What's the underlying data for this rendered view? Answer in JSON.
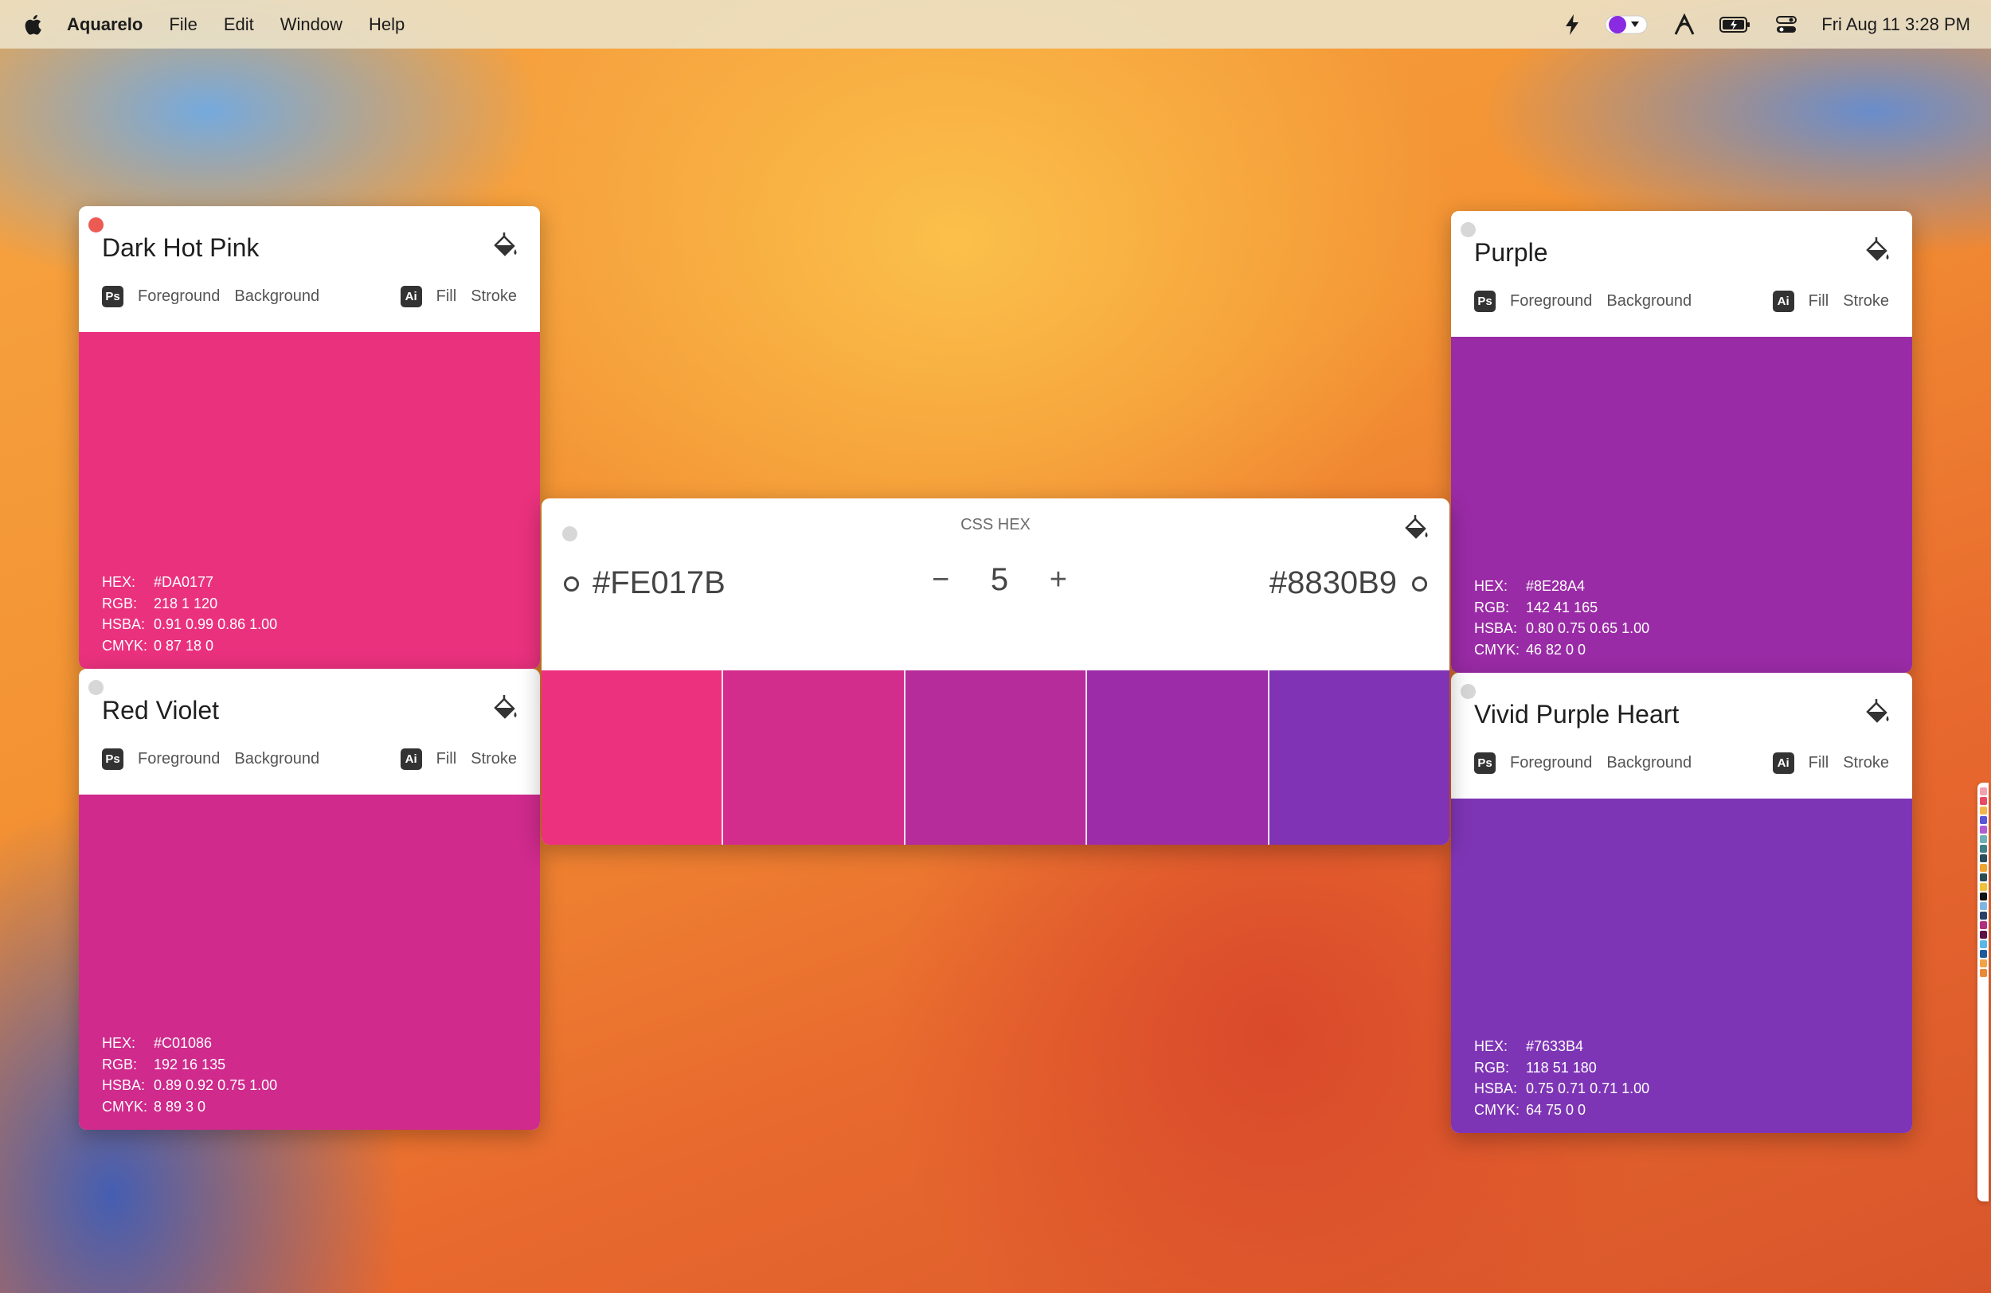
{
  "menubar": {
    "app_name": "Aquarelo",
    "items": [
      "File",
      "Edit",
      "Window",
      "Help"
    ],
    "clock": "Fri Aug 11  3:28 PM",
    "status_icons": [
      "bolt-icon",
      "color-picker-status-icon",
      "font-app-icon",
      "battery-icon",
      "control-center-icon"
    ]
  },
  "labels": {
    "ps": "Ps",
    "ai": "Ai",
    "foreground": "Foreground",
    "background": "Background",
    "fill": "Fill",
    "stroke": "Stroke",
    "hex": "HEX:",
    "rgb": "RGB:",
    "hsba": "HSBA:",
    "cmyk": "CMYK:"
  },
  "cards": [
    {
      "title": "Dark Hot Pink",
      "color": "#DA0177",
      "swatch": "#EA317E",
      "hex": "#DA0177",
      "rgb": "218 1 120",
      "hsba": "0.91 0.99 0.86 1.00",
      "cmyk": "0 87 18 0"
    },
    {
      "title": "Red Violet",
      "color": "#C01086",
      "swatch": "#CF2A8C",
      "hex": "#C01086",
      "rgb": "192 16 135",
      "hsba": "0.89 0.92 0.75 1.00",
      "cmyk": "8 89 3 0"
    },
    {
      "title": "Purple",
      "color": "#8E28A4",
      "swatch": "#9A2BA6",
      "hex": "#8E28A4",
      "rgb": "142 41 165",
      "hsba": "0.80 0.75 0.65 1.00",
      "cmyk": "46 82 0 0"
    },
    {
      "title": "Vivid Purple Heart",
      "color": "#7633B4",
      "swatch": "#7E35B5",
      "hex": "#7633B4",
      "rgb": "118 51 180",
      "hsba": "0.75 0.71 0.71 1.00",
      "cmyk": "64 75 0 0"
    }
  ],
  "gradient": {
    "caption": "CSS HEX",
    "start_hex": "#FE017B",
    "end_hex": "#8830B9",
    "steps": "5",
    "minus": "−",
    "plus": "+",
    "swatches": [
      "#EC317E",
      "#D22C8C",
      "#B62C9B",
      "#9C2CA8",
      "#8033B4"
    ]
  },
  "palette_colors": [
    "#f3a0b0",
    "#e64a66",
    "#f3b64a",
    "#5b56d8",
    "#b35cd1",
    "#6fb0b5",
    "#3f7f86",
    "#2b4c5c",
    "#f0a533",
    "#2c4c55",
    "#f0c23a",
    "#111111",
    "#7fb5e5",
    "#2a3f66",
    "#b0307e",
    "#5c1244",
    "#59b6e6",
    "#1e5a9c",
    "#f1a34a",
    "#e9893a"
  ]
}
